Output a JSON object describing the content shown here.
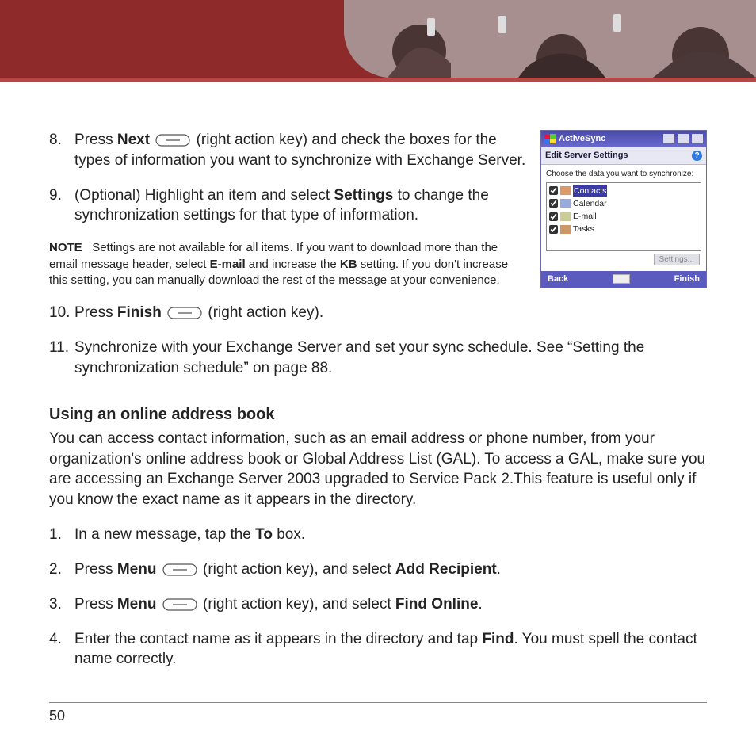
{
  "header": {
    "image_alt": "Three people using mobile phones"
  },
  "steps_top": [
    {
      "num": "8.",
      "chunks": [
        {
          "t": "Press "
        },
        {
          "t": "Next",
          "b": true
        },
        {
          "t": " "
        },
        {
          "icon": "actionkey"
        },
        {
          "t": " (right action key) and check the boxes for the types of information you want to synchronize with Exchange Server."
        }
      ]
    },
    {
      "num": "9.",
      "chunks": [
        {
          "t": "(Optional) Highlight an item and select "
        },
        {
          "t": "Settings",
          "b": true
        },
        {
          "t": " to change the synchronization settings for that type of information."
        }
      ]
    }
  ],
  "note": {
    "label": "NOTE",
    "chunks": [
      {
        "t": "Settings are not available for all items. If you want to download more than the email message header, select "
      },
      {
        "t": "E-mail",
        "b": true
      },
      {
        "t": " and increase the "
      },
      {
        "t": "KB",
        "b": true
      },
      {
        "t": " setting. If you don't increase this setting, you can manually download the rest of the message at your convenience."
      }
    ]
  },
  "steps_mid": [
    {
      "num": "10.",
      "chunks": [
        {
          "t": "Press "
        },
        {
          "t": "Finish",
          "b": true
        },
        {
          "t": " "
        },
        {
          "icon": "actionkey"
        },
        {
          "t": " (right action key)."
        }
      ]
    },
    {
      "num": "11.",
      "chunks": [
        {
          "t": "Synchronize with your Exchange Server and set your sync schedule. See “Setting the synchronization schedule” on page 88."
        }
      ]
    }
  ],
  "section": {
    "heading": "Using an online address book",
    "text": "You can access contact information, such as an email address or phone number, from your organization's online address book or Global Address List (GAL). To access a GAL, make sure you are accessing an Exchange Server 2003 upgraded to Service Pack 2.This feature is useful only if you know the exact name as it appears in the directory."
  },
  "steps_bottom": [
    {
      "num": "1.",
      "chunks": [
        {
          "t": "In a new message, tap the "
        },
        {
          "t": "To",
          "b": true
        },
        {
          "t": " box."
        }
      ]
    },
    {
      "num": "2.",
      "chunks": [
        {
          "t": "Press "
        },
        {
          "t": "Menu",
          "b": true
        },
        {
          "t": " "
        },
        {
          "icon": "actionkey"
        },
        {
          "t": " (right action key), and select "
        },
        {
          "t": "Add Recipient",
          "b": true
        },
        {
          "t": "."
        }
      ]
    },
    {
      "num": "3.",
      "chunks": [
        {
          "t": "Press "
        },
        {
          "t": "Menu",
          "b": true
        },
        {
          "t": " "
        },
        {
          "icon": "actionkey"
        },
        {
          "t": " (right action key), and select "
        },
        {
          "t": "Find Online",
          "b": true
        },
        {
          "t": "."
        }
      ]
    },
    {
      "num": "4.",
      "chunks": [
        {
          "t": "Enter the contact name as it appears in the directory and tap "
        },
        {
          "t": "Find",
          "b": true
        },
        {
          "t": ". You must spell the contact name correctly."
        }
      ]
    }
  ],
  "page_number": "50",
  "device": {
    "title": "ActiveSync",
    "subtitle": "Edit Server Settings",
    "instruction": "Choose the data you want to synchronize:",
    "items": [
      {
        "label": "Contacts",
        "checked": true,
        "selected": true,
        "icon": "ico-contacts"
      },
      {
        "label": "Calendar",
        "checked": true,
        "selected": false,
        "icon": "ico-calendar"
      },
      {
        "label": "E-mail",
        "checked": true,
        "selected": false,
        "icon": "ico-email"
      },
      {
        "label": "Tasks",
        "checked": true,
        "selected": false,
        "icon": "ico-tasks"
      }
    ],
    "settings_button": "Settings...",
    "soft_left": "Back",
    "soft_right": "Finish"
  }
}
